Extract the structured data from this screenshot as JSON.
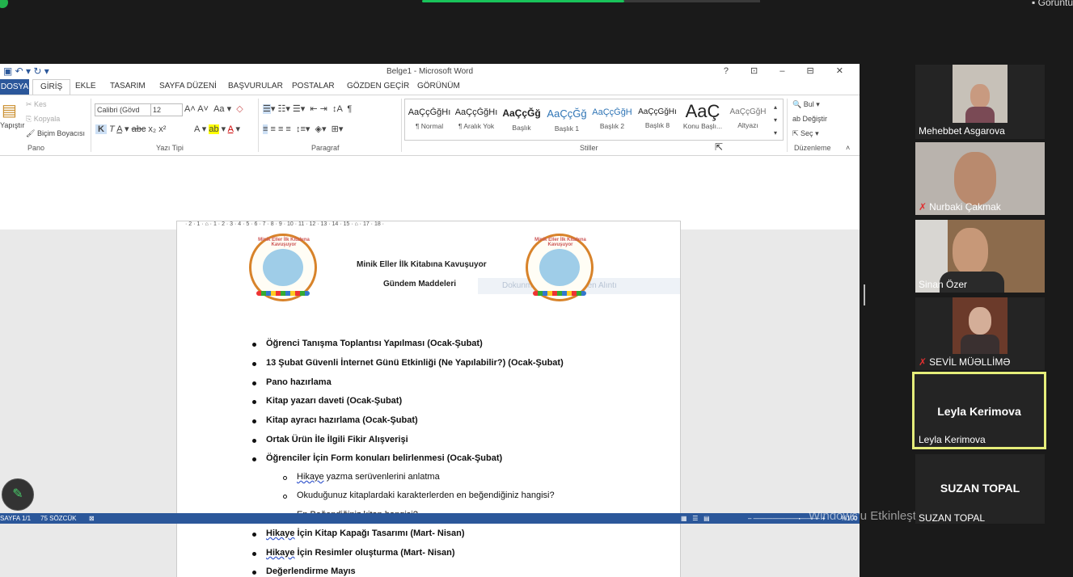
{
  "top": {
    "view_label": "Görüntü"
  },
  "word": {
    "title": "Belge1 - Microsoft Word",
    "window_controls": "? ⊡ – ⊟ ✕",
    "tabs": {
      "file": "DOSYA",
      "home": "GİRİŞ",
      "insert": "EKLE",
      "design": "TASARIM",
      "layout": "SAYFA DÜZENİ",
      "references": "BAŞVURULAR",
      "mailings": "POSTALAR",
      "review": "GÖZDEN GEÇİR",
      "view": "GÖRÜNÜM"
    },
    "clipboard": {
      "paste": "Yapıştır",
      "cut": "Kes",
      "copy": "Kopyala",
      "format_painter": "Biçim Boyacısı",
      "label": "Pano"
    },
    "font": {
      "name": "Calibri (Gövd",
      "size": "12",
      "label": "Yazı Tipi"
    },
    "paragraph": {
      "label": "Paragraf"
    },
    "styles": {
      "label": "Stiller",
      "items": [
        {
          "preview": "AaÇçĞğHı",
          "name": "¶ Normal"
        },
        {
          "preview": "AaÇçĞğHı",
          "name": "¶ Aralık Yok"
        },
        {
          "preview": "AaÇçĞğ",
          "name": "Başlık"
        },
        {
          "preview": "AaÇçĞğ",
          "name": "Başlık 1"
        },
        {
          "preview": "AaÇçĞğH",
          "name": "Başlık 2"
        },
        {
          "preview": "AaÇçĞğHı",
          "name": "Başlık 8"
        },
        {
          "preview": "AaÇ",
          "name": "Konu Başlı..."
        },
        {
          "preview": "AaÇçĞğH",
          "name": "Altyazı"
        }
      ]
    },
    "editing": {
      "find": "Bul",
      "replace": "Değiştir",
      "select": "Seç",
      "label": "Düzenleme"
    },
    "ruler": "· 2 · 1 · ⌂ · 1 · 2 · 3 · 4 · 5 · 6 · 7 · 8 · 9 · 10 · 11 · 12 · 13 · 14 · 15 · ⌂ · 17 · 18 ·",
    "document": {
      "logo_text": "Minik Eller İlk Kitabına Kavuşuyor",
      "header_line1": "Minik Eller İlk Kitabına Kavuşuyor",
      "header_line2": "Gündem Maddeleri",
      "ghost_text": "Dokunma ve Mürekkepten Alıntı",
      "items": [
        "Öğrenci Tanışma Toplantısı Yapılması (Ocak-Şubat)",
        "13 Şubat Güvenli İnternet Günü Etkinliği (Ne Yapılabilir?) (Ocak-Şubat)",
        "Pano hazırlama",
        "Kitap yazarı daveti (Ocak-Şubat)",
        "Kitap ayracı hazırlama (Ocak-Şubat)",
        "Ortak Ürün İle İlgili Fikir Alışverişi",
        "Öğrenciler İçin Form konuları belirlenmesi (Ocak-Şubat)"
      ],
      "subitems": [
        {
          "word": "Hikaye",
          "rest": " yazma serüvenlerini anlatma"
        },
        {
          "word": "",
          "rest": "Okuduğunuz kitaplardaki karakterlerden en beğendiğiniz hangisi?"
        },
        {
          "word": "",
          "rest": "En Beğendiğiniz kitap hangisi?"
        }
      ],
      "items2": [
        {
          "word": "Hikaye",
          "rest": " İçin Kitap Kapağı Tasarımı (Mart- Nisan)"
        },
        {
          "word": "Hikaye",
          "rest": " İçin Resimler oluşturma (Mart- Nisan)"
        },
        {
          "word": "",
          "rest": "Değerlendirme Mayıs"
        }
      ]
    },
    "status": {
      "page": "SAYFA 1/1",
      "words": "75 SÖZCÜK",
      "zoom": "%100"
    }
  },
  "windows_watermark": "Windows'u Etkinleştir",
  "participants": [
    {
      "name": "Mehebbet Asgarova",
      "muted": false
    },
    {
      "name": "Nurbaki Çakmak",
      "muted": true
    },
    {
      "name": "Sinan Özer",
      "muted": false
    },
    {
      "name": "SEVİL MÜƏLLİMƏ",
      "muted": true
    },
    {
      "name": "Leyla Kerimova",
      "big": "Leyla Kerimova",
      "muted": false
    },
    {
      "name": "SUZAN TOPAL",
      "big": "SUZAN TOPAL",
      "muted": false
    }
  ],
  "colors": {
    "word_blue": "#2b579a",
    "active_speaker": "#e5ed7a",
    "zoom_green": "#19c35a"
  }
}
